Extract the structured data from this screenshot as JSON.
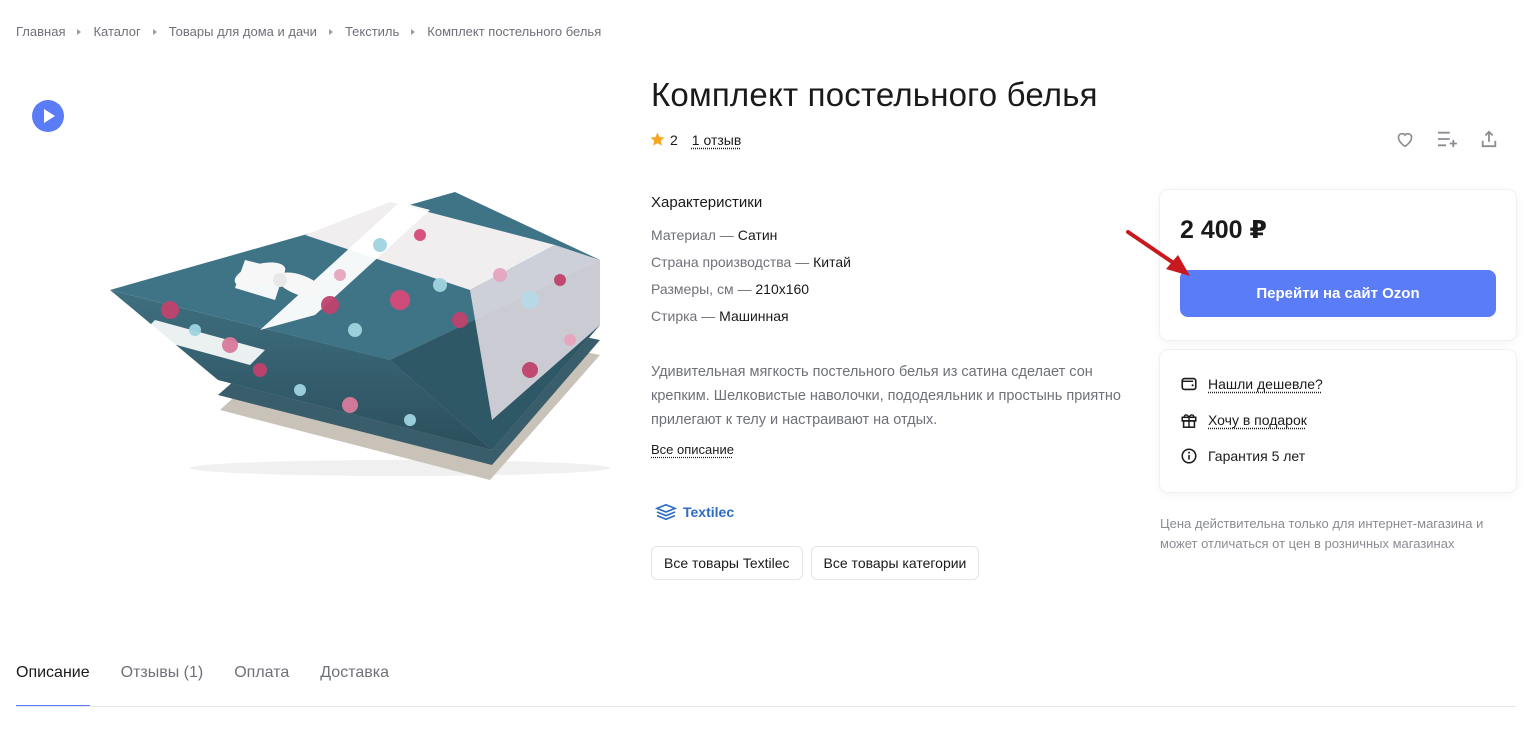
{
  "breadcrumb": [
    "Главная",
    "Каталог",
    "Товары для дома и дачи",
    "Текстиль",
    "Комплект постельного белья"
  ],
  "product": {
    "title": "Комплект постельного белья",
    "rating": "2",
    "reviews_link": "1 отзыв"
  },
  "characteristics": {
    "heading": "Характеристики",
    "rows": [
      {
        "label": "Материал — ",
        "value": "Сатин"
      },
      {
        "label": "Страна производства — ",
        "value": "Китай"
      },
      {
        "label": "Размеры, см — ",
        "value": "210х160"
      },
      {
        "label": "Стирка — ",
        "value": "Машинная"
      }
    ]
  },
  "description": {
    "text": "Удивительная мягкость постельного белья из сатина сделает сон крепким. Шелковистые наволочки, пододеяльник и простынь приятно прилегают к телу и настраивают на отдых.",
    "all_link": "Все описание"
  },
  "brand": {
    "name": "Textilec",
    "chips": [
      "Все товары Textilec",
      "Все товары категории"
    ]
  },
  "price_card": {
    "price": "2 400 ₽",
    "buy_label": "Перейти на сайт Ozon"
  },
  "info_card": {
    "cheaper": "Нашли дешевле?",
    "gift": "Хочу в подарок",
    "warranty": "Гарантия 5 лет"
  },
  "note": "Цена действительна только для интернет-магазина и может отличаться от цен в розничных магазинах",
  "tabs": [
    "Описание",
    "Отзывы (1)",
    "Оплата",
    "Доставка"
  ],
  "colors": {
    "accent": "#5b7cf7",
    "brand": "#2d6cc4",
    "star": "#f5a623",
    "arrow": "#c8191e"
  },
  "icons": [
    "play-icon",
    "star-icon",
    "heart-icon",
    "add-to-list-icon",
    "share-icon",
    "textilec-logo-icon",
    "wallet-icon",
    "gift-icon",
    "info-icon",
    "red-arrow"
  ]
}
